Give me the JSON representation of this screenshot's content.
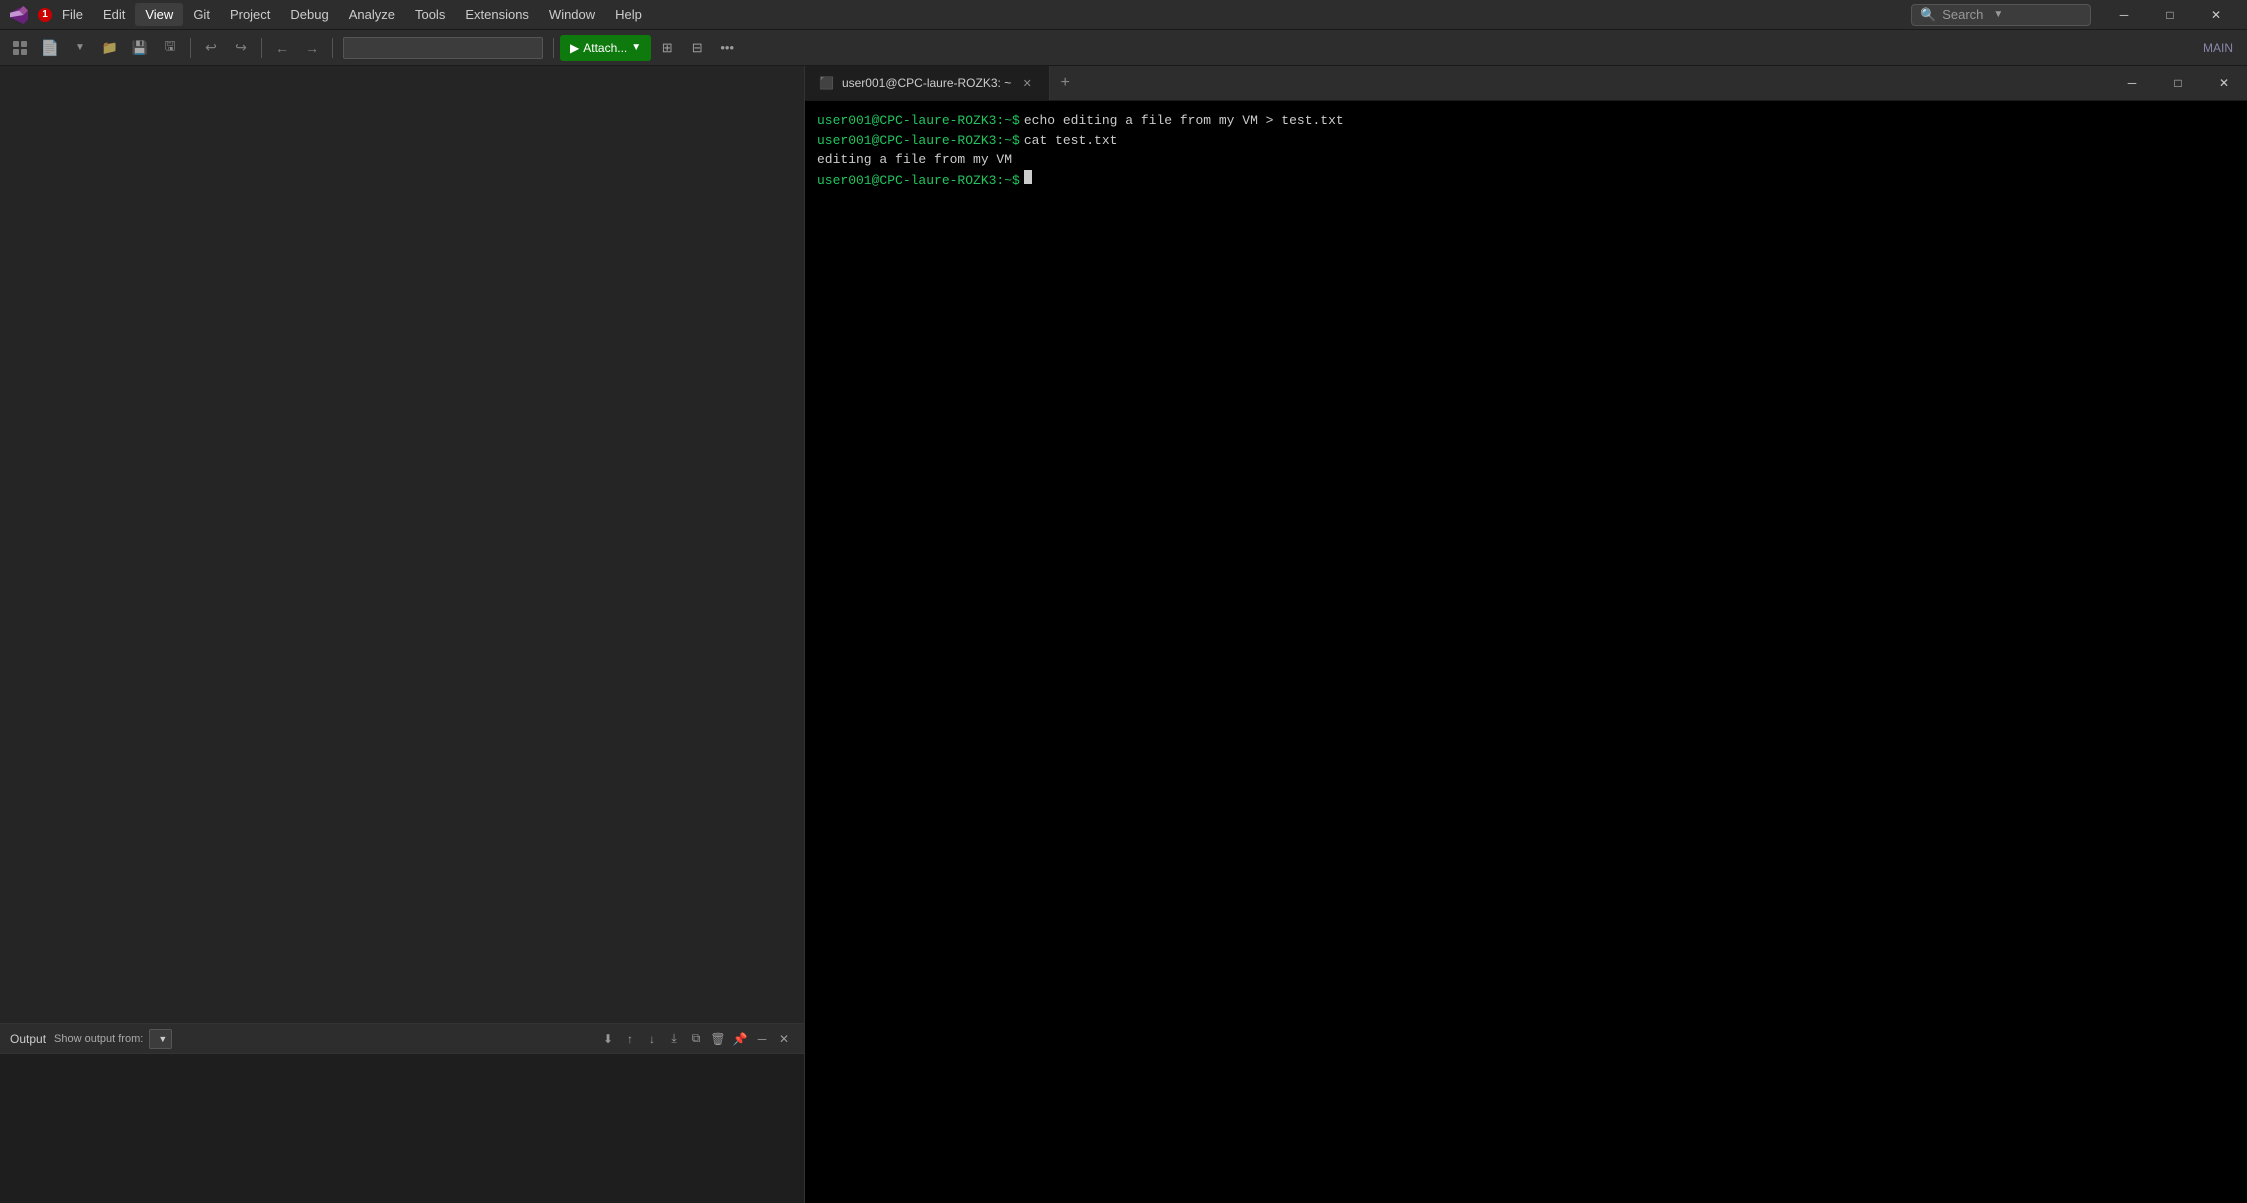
{
  "app": {
    "title": "Visual Studio",
    "notification_count": "1"
  },
  "menu": {
    "items": [
      {
        "label": "File",
        "id": "file"
      },
      {
        "label": "Edit",
        "id": "edit"
      },
      {
        "label": "View",
        "id": "view"
      },
      {
        "label": "Git",
        "id": "git"
      },
      {
        "label": "Project",
        "id": "project"
      },
      {
        "label": "Debug",
        "id": "debug"
      },
      {
        "label": "Analyze",
        "id": "analyze"
      },
      {
        "label": "Tools",
        "id": "tools"
      },
      {
        "label": "Extensions",
        "id": "extensions"
      },
      {
        "label": "Window",
        "id": "window"
      },
      {
        "label": "Help",
        "id": "help"
      }
    ],
    "search_label": "Search",
    "search_placeholder": "Search"
  },
  "window_controls": {
    "minimize": "─",
    "maximize": "□",
    "close": "✕"
  },
  "toolbar": {
    "attach_label": "Attach...",
    "main_label": "MAIN"
  },
  "output_panel": {
    "title": "Output",
    "show_output_from": "Show output from:"
  },
  "terminal": {
    "tab_title": "user001@CPC-laure-ROZK3: ~",
    "lines": [
      {
        "prompt": "user001@CPC-laure-ROZK3:~$",
        "command": " echo editing a file from my VM > test.txt"
      },
      {
        "prompt": "user001@CPC-laure-ROZK3:~$",
        "command": " cat test.txt"
      },
      {
        "output": "editing a file from my VM"
      },
      {
        "prompt": "user001@CPC-laure-ROZK3:~$",
        "command": "",
        "cursor": true
      }
    ]
  }
}
